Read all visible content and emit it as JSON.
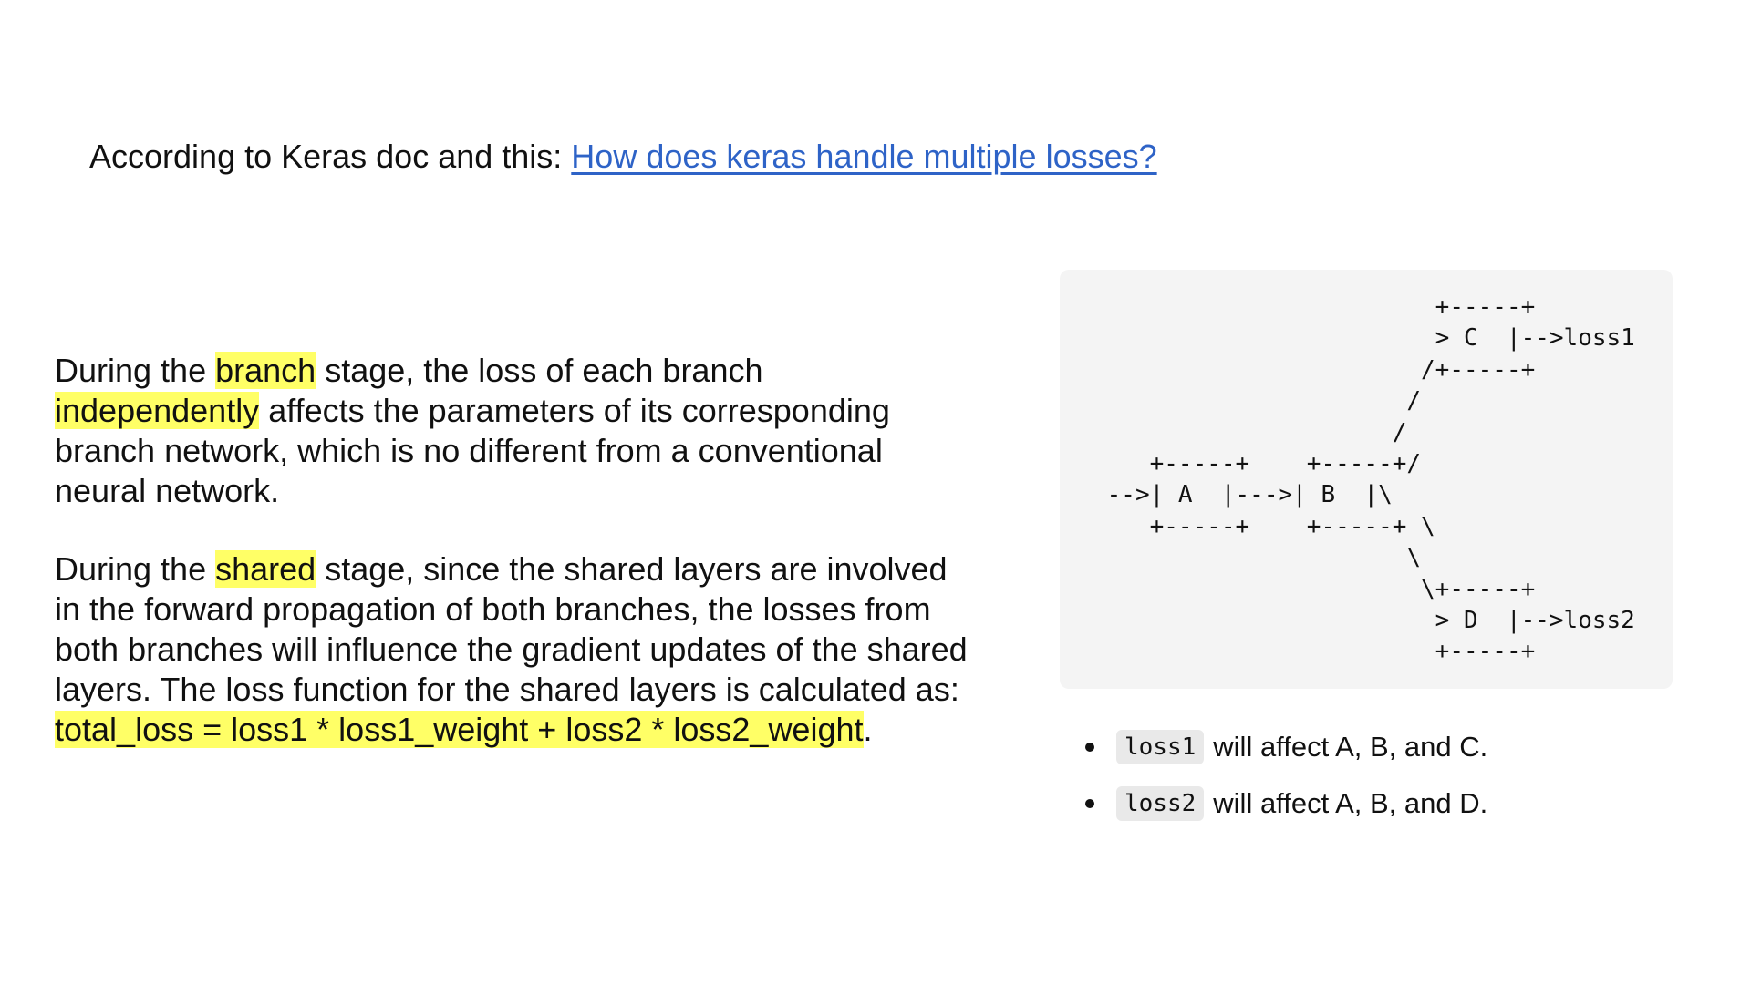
{
  "intro": {
    "text": "According to Keras doc and this: ",
    "link_text": "How does keras handle multiple losses?"
  },
  "paragraph1": {
    "t1": "During the ",
    "h1": "branch",
    "t2": " stage, the loss of each branch ",
    "h2": "independently",
    "t3": " affects the parameters of its corresponding branch network, which is no different from a conventional neural network."
  },
  "paragraph2": {
    "t1": "During the ",
    "h1": "shared",
    "t2": " stage, since the shared layers are involved in the forward propagation of both branches, the losses from both branches will influence the gradient updates of the shared layers. The loss function for the shared layers is calculated as: ",
    "formula": "total_loss = loss1 * loss1_weight + loss2 * loss2_weight",
    "t3": "."
  },
  "diagram": {
    "ascii": "                        +-----+\n                        > C  |-->loss1\n                       /+-----+\n                      /\n                     /\n    +-----+    +-----+/\n -->| A  |--->| B  |\\\n    +-----+    +-----+ \\\n                      \\\n                       \\+-----+\n                        > D  |-->loss2\n                        +-----+"
  },
  "bullets": [
    {
      "code": "loss1",
      "text": "will affect A, B, and C."
    },
    {
      "code": "loss2",
      "text": "will affect A, B, and D."
    }
  ],
  "colors": {
    "highlight": "#ffff66",
    "link": "#2e63c7",
    "code_background": "#f4f4f4"
  }
}
